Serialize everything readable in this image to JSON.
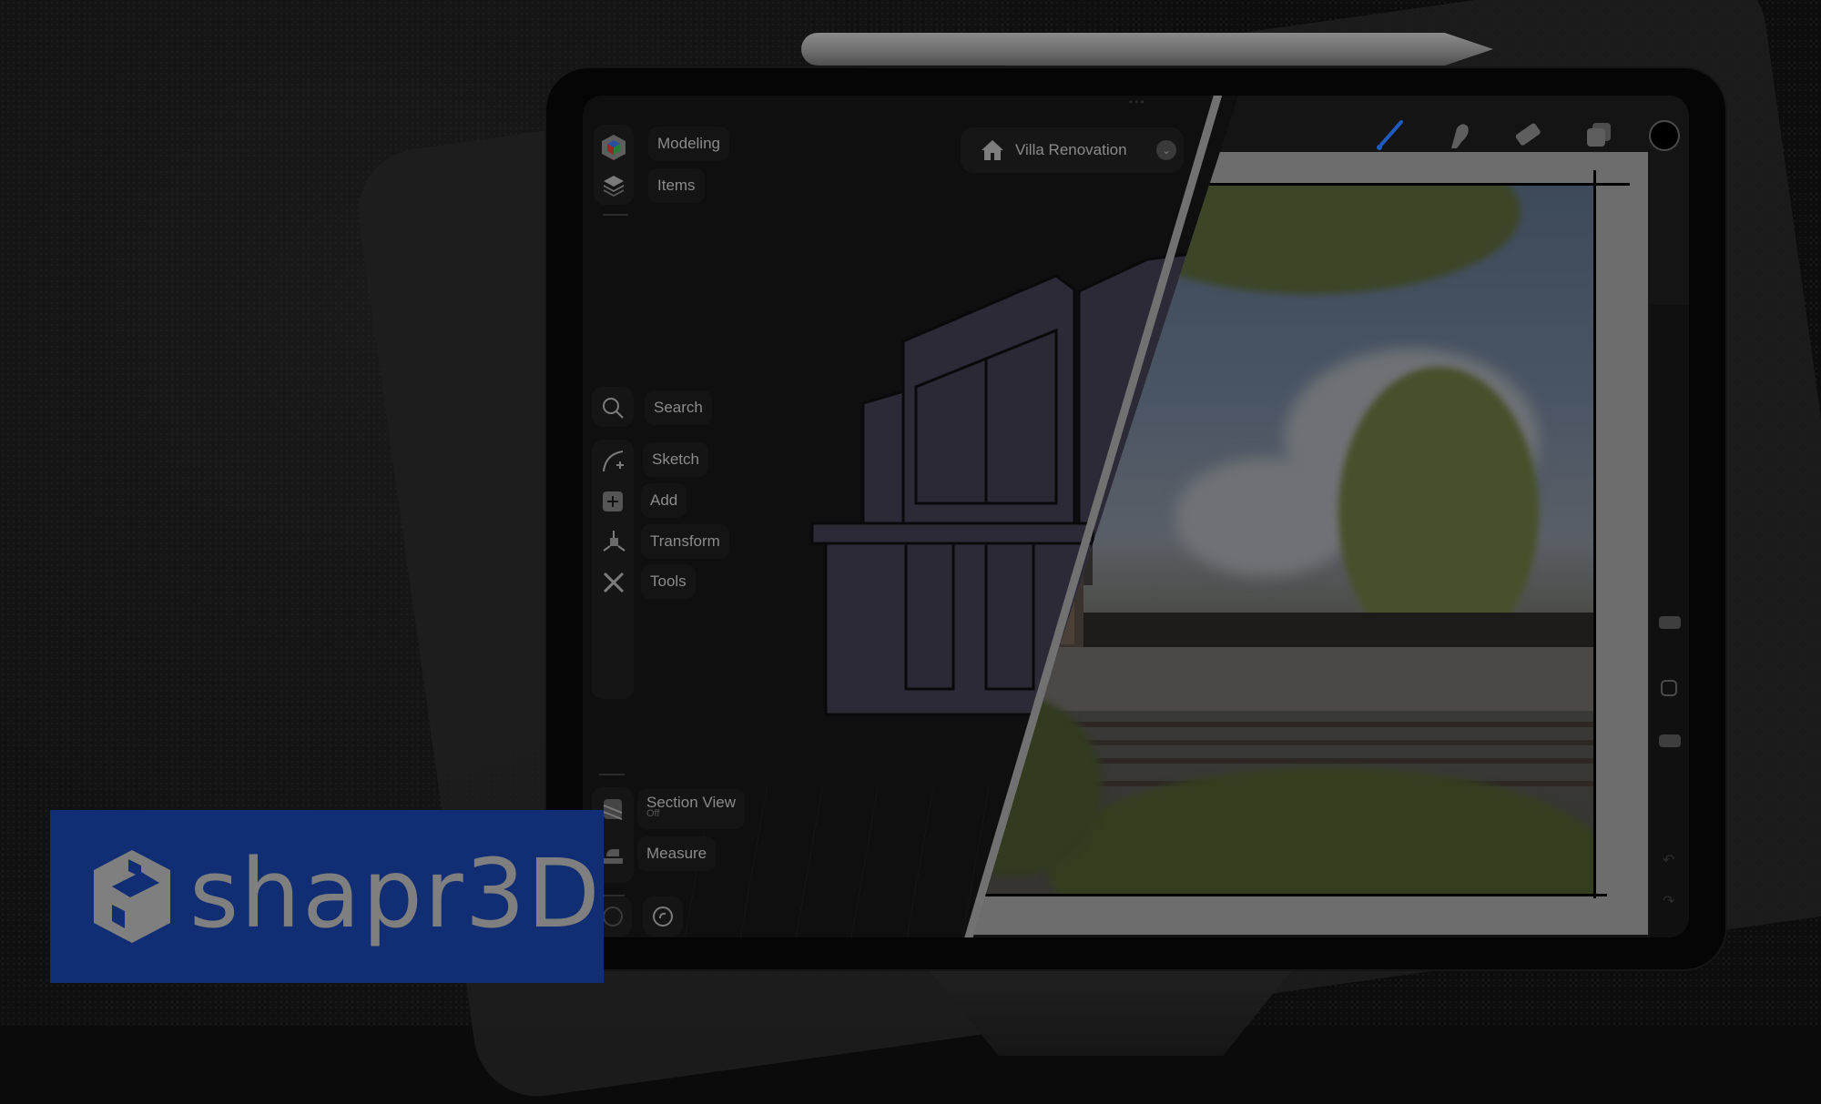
{
  "app": {
    "name": "Shapr3D",
    "logo_text": "shapr3D",
    "brand_color": "#112d73"
  },
  "header": {
    "project_title": "Villa Renovation",
    "home_icon": "house-icon",
    "dropdown_icon": "chevron-down-icon"
  },
  "sidebar": {
    "top": [
      {
        "label": "Modeling",
        "icon": "modeling-cube-icon"
      },
      {
        "label": "Items",
        "icon": "layers-icon"
      }
    ],
    "tools": [
      {
        "label": "Search",
        "icon": "search-icon"
      },
      {
        "label": "Sketch",
        "icon": "sketch-arc-icon"
      },
      {
        "label": "Add",
        "icon": "add-square-icon"
      },
      {
        "label": "Transform",
        "icon": "transform-icon"
      },
      {
        "label": "Tools",
        "icon": "tools-icon"
      }
    ],
    "bottom": [
      {
        "label": "Section View",
        "sublabel": "Off",
        "icon": "section-view-icon"
      },
      {
        "label": "Measure",
        "icon": "measure-icon"
      }
    ],
    "history": [
      {
        "icon": "undo-icon"
      },
      {
        "icon": "redo-icon"
      }
    ]
  },
  "paint_toolbar": {
    "tools": [
      {
        "name": "brush",
        "icon": "brush-icon",
        "active": true,
        "color": "#1f5bbf"
      },
      {
        "name": "smudge",
        "icon": "smudge-icon",
        "active": false
      },
      {
        "name": "eraser",
        "icon": "eraser-icon",
        "active": false
      },
      {
        "name": "layers",
        "icon": "layers-stack-icon",
        "active": false
      },
      {
        "name": "color",
        "icon": "color-swatch-icon",
        "active": false,
        "color": "#000000"
      }
    ]
  },
  "side_rail": {
    "brush_size_slider": "brush-size-slider",
    "modify_button": "modify-square-button",
    "opacity_slider": "opacity-slider",
    "undo_icon": "undo-icon",
    "redo_icon": "redo-icon"
  }
}
